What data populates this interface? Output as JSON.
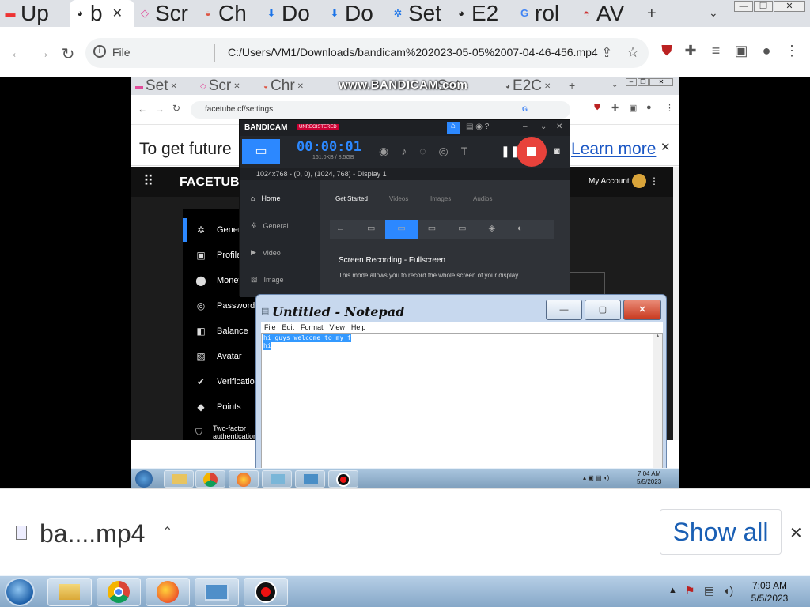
{
  "browser": {
    "tabs": [
      {
        "label": "Up",
        "icon": "youtube-icon"
      },
      {
        "label": "b",
        "icon": "globe-icon"
      },
      {
        "label": "Scr",
        "icon": "tab-icon"
      },
      {
        "label": "Ch",
        "icon": "tab-icon"
      },
      {
        "label": "Do",
        "icon": "download-icon"
      },
      {
        "label": "Do",
        "icon": "download-icon"
      },
      {
        "label": "Set",
        "icon": "gear-icon"
      },
      {
        "label": "E2",
        "icon": "globe-icon"
      },
      {
        "label": "rol",
        "icon": "google-icon"
      },
      {
        "label": "AV",
        "icon": "tab-icon"
      }
    ],
    "new_tab": "+",
    "scheme": "File",
    "url": "C:/Users/VM1/Downloads/bandicam%202023-05-05%2007-04-46-456.mp4"
  },
  "video": {
    "inner_tabs": [
      "Set",
      "Scr",
      "Chr",
      "Set",
      "E2C"
    ],
    "watermark": "www.BANDICAM.com",
    "inner_url": "facetube.cf/settings",
    "infobar_text": "To get future",
    "infobar_link": "Learn more",
    "facetube": {
      "logo": "FACETUBE",
      "account": "My Account",
      "menu": [
        "General",
        "Profile",
        "Money",
        "Password",
        "Balance",
        "Avatar",
        "Verification",
        "Points",
        "Two-factor authentication"
      ]
    },
    "bandicam": {
      "brand": "BANDICAM",
      "badge": "UNREGISTERED",
      "timer": "00:00:01",
      "size": "161.0KB / 8.5GB",
      "resolution": "1024x768 - (0, 0), (1024, 768) - Display 1",
      "nav": [
        "Home",
        "General",
        "Video",
        "Image"
      ],
      "tabs": [
        "Get Started",
        "Videos",
        "Images",
        "Audios"
      ],
      "mode_title": "Screen Recording - Fullscreen",
      "mode_desc": "This mode allows you to record the whole screen of your display."
    },
    "notepad": {
      "title": "Untitled - Notepad",
      "menu": [
        "File",
        "Edit",
        "Format",
        "View",
        "Help"
      ],
      "line1": "hi guys welcome to my f",
      "line2": "hi"
    },
    "inner_clock": {
      "time": "7:04 AM",
      "date": "5/5/2023"
    }
  },
  "downloads": {
    "file": "ba....mp4",
    "show_all": "Show all"
  },
  "taskbar": {
    "time": "7:09 AM",
    "date": "5/5/2023"
  },
  "colors": {
    "accent": "#1a5fb4",
    "record": "#e8423b",
    "bandicam_blue": "#2c88ff"
  }
}
